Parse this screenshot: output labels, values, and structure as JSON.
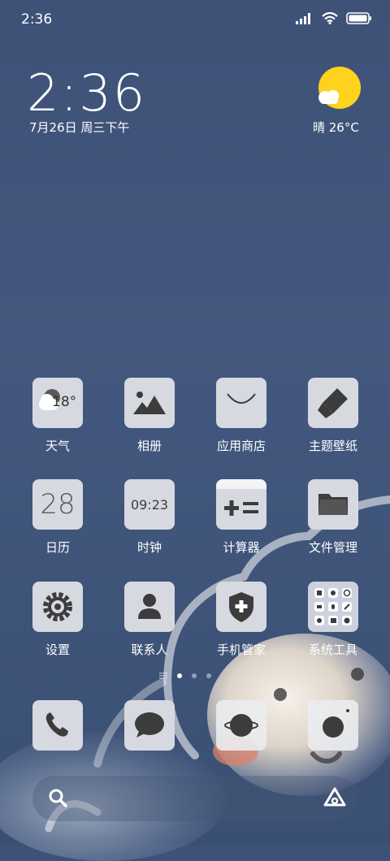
{
  "status": {
    "time": "2:36"
  },
  "clock": {
    "time": "2:36",
    "date": "7月26日 周三下午"
  },
  "weather": {
    "text": "晴 26°C",
    "icon_temp": "18°"
  },
  "apps": [
    {
      "label": "天气",
      "icon": "weather-icon"
    },
    {
      "label": "相册",
      "icon": "gallery-icon"
    },
    {
      "label": "应用商店",
      "icon": "app-store-icon"
    },
    {
      "label": "主题壁纸",
      "icon": "themes-icon"
    },
    {
      "label": "日历",
      "icon": "calendar-icon",
      "icon_text": "28"
    },
    {
      "label": "时钟",
      "icon": "clock-icon",
      "icon_text": "09:23"
    },
    {
      "label": "计算器",
      "icon": "calculator-icon"
    },
    {
      "label": "文件管理",
      "icon": "folder-icon"
    },
    {
      "label": "设置",
      "icon": "settings-icon"
    },
    {
      "label": "联系人",
      "icon": "contacts-icon"
    },
    {
      "label": "手机管家",
      "icon": "security-icon"
    },
    {
      "label": "系统工具",
      "icon": "tools-folder-icon"
    }
  ],
  "dock": [
    {
      "icon": "phone-icon"
    },
    {
      "icon": "messages-icon"
    },
    {
      "icon": "browser-icon"
    },
    {
      "icon": "camera-icon"
    }
  ],
  "colors": {
    "icon_bg": "#d7d9e0",
    "icon_fg": "#3c3c3c",
    "sun": "#ffd21e",
    "wallpaper": "#3f5479"
  }
}
